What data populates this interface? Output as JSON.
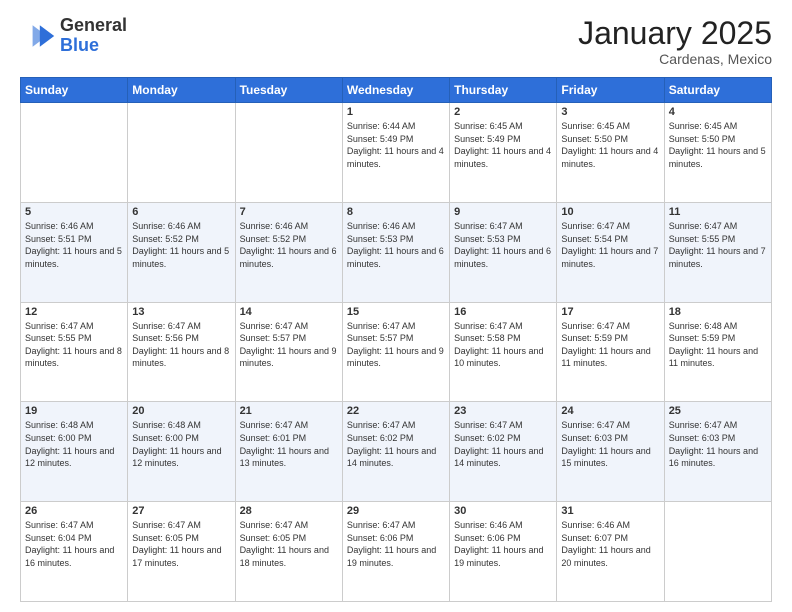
{
  "header": {
    "logo_line1": "General",
    "logo_line2": "Blue",
    "month": "January 2025",
    "location": "Cardenas, Mexico"
  },
  "weekdays": [
    "Sunday",
    "Monday",
    "Tuesday",
    "Wednesday",
    "Thursday",
    "Friday",
    "Saturday"
  ],
  "weeks": [
    [
      {
        "day": "",
        "info": ""
      },
      {
        "day": "",
        "info": ""
      },
      {
        "day": "",
        "info": ""
      },
      {
        "day": "1",
        "info": "Sunrise: 6:44 AM\nSunset: 5:49 PM\nDaylight: 11 hours and 4 minutes."
      },
      {
        "day": "2",
        "info": "Sunrise: 6:45 AM\nSunset: 5:49 PM\nDaylight: 11 hours and 4 minutes."
      },
      {
        "day": "3",
        "info": "Sunrise: 6:45 AM\nSunset: 5:50 PM\nDaylight: 11 hours and 4 minutes."
      },
      {
        "day": "4",
        "info": "Sunrise: 6:45 AM\nSunset: 5:50 PM\nDaylight: 11 hours and 5 minutes."
      }
    ],
    [
      {
        "day": "5",
        "info": "Sunrise: 6:46 AM\nSunset: 5:51 PM\nDaylight: 11 hours and 5 minutes."
      },
      {
        "day": "6",
        "info": "Sunrise: 6:46 AM\nSunset: 5:52 PM\nDaylight: 11 hours and 5 minutes."
      },
      {
        "day": "7",
        "info": "Sunrise: 6:46 AM\nSunset: 5:52 PM\nDaylight: 11 hours and 6 minutes."
      },
      {
        "day": "8",
        "info": "Sunrise: 6:46 AM\nSunset: 5:53 PM\nDaylight: 11 hours and 6 minutes."
      },
      {
        "day": "9",
        "info": "Sunrise: 6:47 AM\nSunset: 5:53 PM\nDaylight: 11 hours and 6 minutes."
      },
      {
        "day": "10",
        "info": "Sunrise: 6:47 AM\nSunset: 5:54 PM\nDaylight: 11 hours and 7 minutes."
      },
      {
        "day": "11",
        "info": "Sunrise: 6:47 AM\nSunset: 5:55 PM\nDaylight: 11 hours and 7 minutes."
      }
    ],
    [
      {
        "day": "12",
        "info": "Sunrise: 6:47 AM\nSunset: 5:55 PM\nDaylight: 11 hours and 8 minutes."
      },
      {
        "day": "13",
        "info": "Sunrise: 6:47 AM\nSunset: 5:56 PM\nDaylight: 11 hours and 8 minutes."
      },
      {
        "day": "14",
        "info": "Sunrise: 6:47 AM\nSunset: 5:57 PM\nDaylight: 11 hours and 9 minutes."
      },
      {
        "day": "15",
        "info": "Sunrise: 6:47 AM\nSunset: 5:57 PM\nDaylight: 11 hours and 9 minutes."
      },
      {
        "day": "16",
        "info": "Sunrise: 6:47 AM\nSunset: 5:58 PM\nDaylight: 11 hours and 10 minutes."
      },
      {
        "day": "17",
        "info": "Sunrise: 6:47 AM\nSunset: 5:59 PM\nDaylight: 11 hours and 11 minutes."
      },
      {
        "day": "18",
        "info": "Sunrise: 6:48 AM\nSunset: 5:59 PM\nDaylight: 11 hours and 11 minutes."
      }
    ],
    [
      {
        "day": "19",
        "info": "Sunrise: 6:48 AM\nSunset: 6:00 PM\nDaylight: 11 hours and 12 minutes."
      },
      {
        "day": "20",
        "info": "Sunrise: 6:48 AM\nSunset: 6:00 PM\nDaylight: 11 hours and 12 minutes."
      },
      {
        "day": "21",
        "info": "Sunrise: 6:47 AM\nSunset: 6:01 PM\nDaylight: 11 hours and 13 minutes."
      },
      {
        "day": "22",
        "info": "Sunrise: 6:47 AM\nSunset: 6:02 PM\nDaylight: 11 hours and 14 minutes."
      },
      {
        "day": "23",
        "info": "Sunrise: 6:47 AM\nSunset: 6:02 PM\nDaylight: 11 hours and 14 minutes."
      },
      {
        "day": "24",
        "info": "Sunrise: 6:47 AM\nSunset: 6:03 PM\nDaylight: 11 hours and 15 minutes."
      },
      {
        "day": "25",
        "info": "Sunrise: 6:47 AM\nSunset: 6:03 PM\nDaylight: 11 hours and 16 minutes."
      }
    ],
    [
      {
        "day": "26",
        "info": "Sunrise: 6:47 AM\nSunset: 6:04 PM\nDaylight: 11 hours and 16 minutes."
      },
      {
        "day": "27",
        "info": "Sunrise: 6:47 AM\nSunset: 6:05 PM\nDaylight: 11 hours and 17 minutes."
      },
      {
        "day": "28",
        "info": "Sunrise: 6:47 AM\nSunset: 6:05 PM\nDaylight: 11 hours and 18 minutes."
      },
      {
        "day": "29",
        "info": "Sunrise: 6:47 AM\nSunset: 6:06 PM\nDaylight: 11 hours and 19 minutes."
      },
      {
        "day": "30",
        "info": "Sunrise: 6:46 AM\nSunset: 6:06 PM\nDaylight: 11 hours and 19 minutes."
      },
      {
        "day": "31",
        "info": "Sunrise: 6:46 AM\nSunset: 6:07 PM\nDaylight: 11 hours and 20 minutes."
      },
      {
        "day": "",
        "info": ""
      }
    ]
  ]
}
